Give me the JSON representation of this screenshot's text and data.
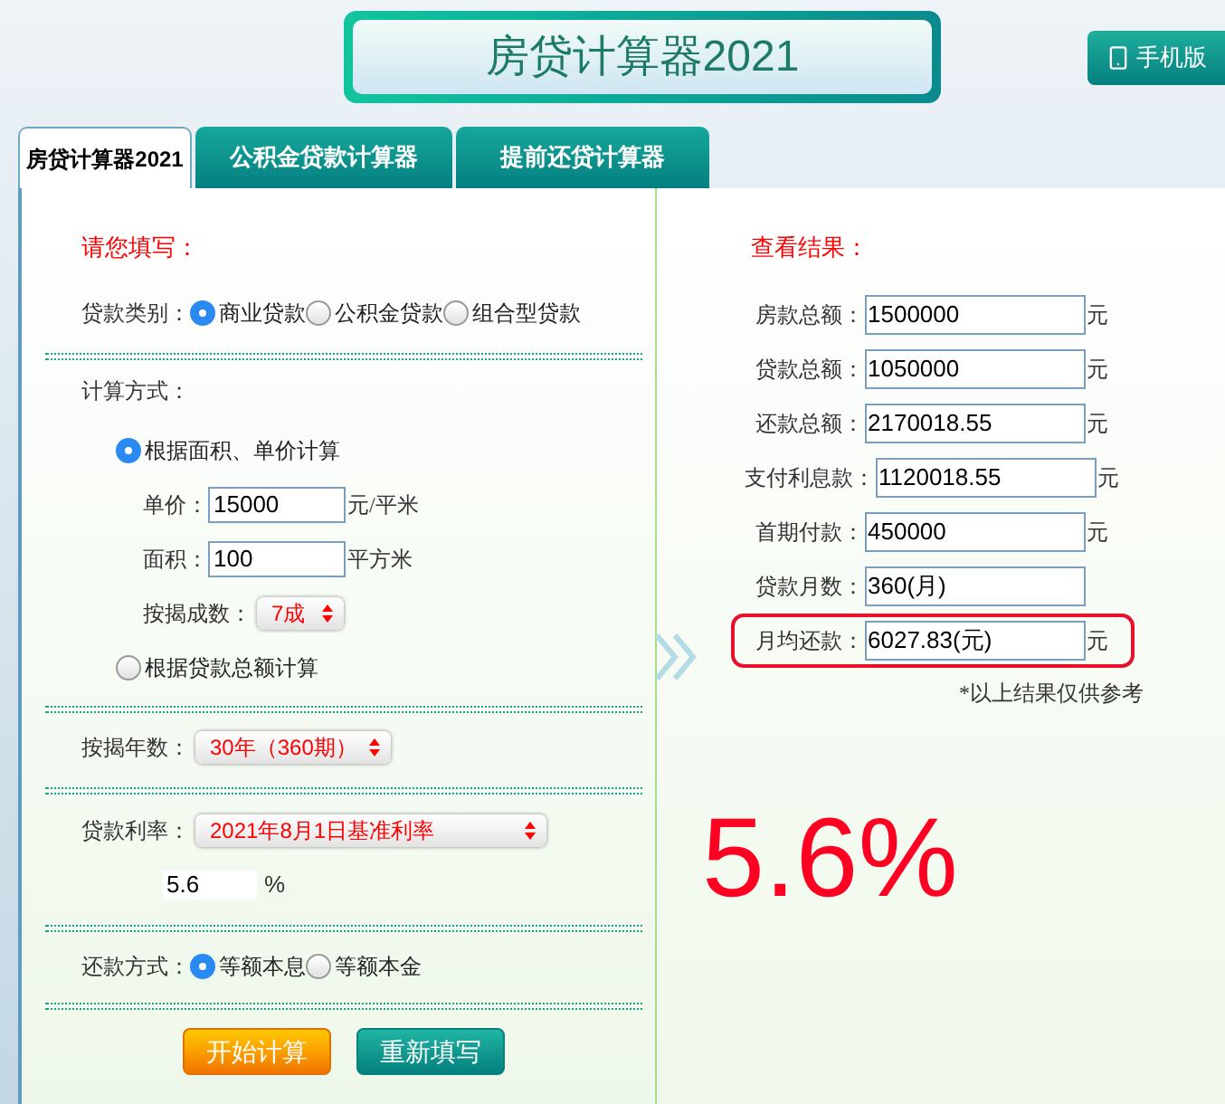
{
  "header": {
    "title": "房贷计算器2021",
    "mobile_button": "手机版"
  },
  "tabs": [
    {
      "label": "房贷计算器2021",
      "selected": true
    },
    {
      "label": "公积金贷款计算器",
      "selected": false
    },
    {
      "label": "提前还贷计算器",
      "selected": false
    }
  ],
  "form": {
    "heading": "请您填写：",
    "loan_type": {
      "label": "贷款类别：",
      "options": [
        {
          "label": "商业贷款",
          "selected": true
        },
        {
          "label": "公积金贷款",
          "selected": false
        },
        {
          "label": "组合型贷款",
          "selected": false
        }
      ]
    },
    "calc_method": {
      "label": "计算方式：",
      "options": [
        {
          "label": "根据面积、单价计算",
          "selected": true,
          "fields": [
            {
              "kind": "input",
              "label": "单价：",
              "value": "15000",
              "unit": "元/平米"
            },
            {
              "kind": "input",
              "label": "面积：",
              "value": "100",
              "unit": "平方米"
            },
            {
              "kind": "select",
              "label": "按揭成数：",
              "value": "7成"
            }
          ]
        },
        {
          "label": "根据贷款总额计算",
          "selected": false
        }
      ]
    },
    "term": {
      "label": "按揭年数：",
      "value": "30年（360期）"
    },
    "rate": {
      "label": "贷款利率：",
      "value": "2021年8月1日基准利率",
      "input_value": "5.6",
      "unit": "%"
    },
    "repayment": {
      "label": "还款方式：",
      "options": [
        {
          "label": "等额本息",
          "selected": true
        },
        {
          "label": "等额本金",
          "selected": false
        }
      ]
    },
    "buttons": [
      {
        "label": "开始计算",
        "kind": "primary"
      },
      {
        "label": "重新填写",
        "kind": "secondary"
      }
    ]
  },
  "results": {
    "heading": "查看结果：",
    "rows": [
      {
        "label": "房款总额：",
        "value": "1500000",
        "unit": "元",
        "highlighted": false
      },
      {
        "label": "贷款总额：",
        "value": "1050000",
        "unit": "元",
        "highlighted": false
      },
      {
        "label": "还款总额：",
        "value": "2170018.55",
        "unit": "元",
        "highlighted": false
      },
      {
        "label": "支付利息款：",
        "value": "1120018.55",
        "unit": "元",
        "highlighted": false
      },
      {
        "label": "首期付款：",
        "value": "450000",
        "unit": "元",
        "highlighted": false
      },
      {
        "label": "贷款月数：",
        "value": "360(月)",
        "highlighted": false
      },
      {
        "label": "月均还款：",
        "value": "6027.83(元)",
        "unit": "元",
        "highlighted": true
      }
    ],
    "note": "*以上结果仅供参考",
    "rate_display": "5.6%"
  }
}
